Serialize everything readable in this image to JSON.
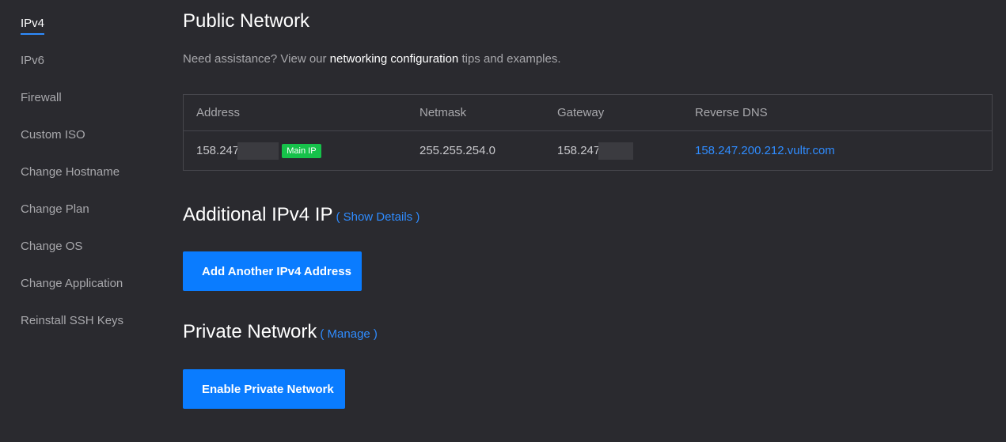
{
  "sidebar": {
    "items": [
      {
        "label": "IPv4",
        "active": true
      },
      {
        "label": "IPv6"
      },
      {
        "label": "Firewall"
      },
      {
        "label": "Custom ISO"
      },
      {
        "label": "Change Hostname"
      },
      {
        "label": "Change Plan"
      },
      {
        "label": "Change OS"
      },
      {
        "label": "Change Application"
      },
      {
        "label": "Reinstall SSH Keys"
      }
    ]
  },
  "public_network": {
    "title": "Public Network",
    "assist_prefix": "Need assistance? View our ",
    "assist_link": "networking configuration",
    "assist_suffix": " tips and examples.",
    "table": {
      "headers": [
        "Address",
        "Netmask",
        "Gateway",
        "Reverse DNS"
      ],
      "row": {
        "address": "158.247",
        "badge": "Main IP",
        "netmask": "255.255.254.0",
        "gateway": "158.247",
        "reverse_dns": "158.247.200.212.vultr.com"
      }
    }
  },
  "additional_ipv4": {
    "title": "Additional IPv4 IP",
    "link": "( Show Details )",
    "button": "Add Another IPv4 Address"
  },
  "private_network": {
    "title": "Private Network",
    "link": "( Manage )",
    "button": "Enable Private Network"
  },
  "colors": {
    "background": "#2a2a2f",
    "accent": "#0a7cff",
    "link": "#2f8cff",
    "badge": "#16c24a"
  }
}
